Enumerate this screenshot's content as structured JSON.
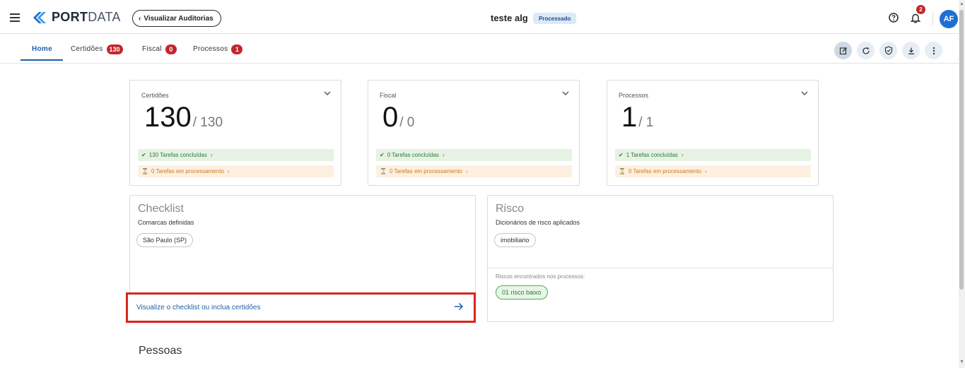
{
  "header": {
    "logo_text_bold": "PORT",
    "logo_text_light": "DATA",
    "back_label": "Visualizar Auditorias",
    "title": "teste alg",
    "status": "Processado",
    "notifications_count": "2",
    "avatar_initials": "AF",
    "accent_color": "#1f6ed4"
  },
  "tabs": [
    {
      "label": "Home",
      "badge": null,
      "active": true
    },
    {
      "label": "Certidões",
      "badge": "130"
    },
    {
      "label": "Fiscal",
      "badge": "0"
    },
    {
      "label": "Processos",
      "badge": "1"
    }
  ],
  "toolbar": {
    "icons": [
      "edit-icon",
      "refresh-icon",
      "shield-check-icon",
      "download-icon",
      "more-vertical-icon"
    ]
  },
  "cards": [
    {
      "label": "Certidões",
      "value": "130",
      "total": "/ 130",
      "done": "130 Tarefas concluídas",
      "processing": "0 Tarefas em processamento"
    },
    {
      "label": "Fiscal",
      "value": "0",
      "total": "/ 0",
      "done": "0 Tarefas concluídas",
      "processing": "0 Tarefas em processamento"
    },
    {
      "label": "Processos",
      "value": "1",
      "total": "/ 1",
      "done": "1 Tarefas concluídas",
      "processing": "0 Tarefas em processamento"
    }
  ],
  "checklist": {
    "title": "Checklist",
    "subtitle": "Comarcas definidas",
    "chip": "São Paulo (SP)",
    "link": "Visualize o checklist ou inclua certidões"
  },
  "risk": {
    "title": "Risco",
    "subtitle": "Dicionários de risco aplicados",
    "chip": "imobiliario",
    "found_label": "Riscos encontrados nos processos:",
    "found_chip": "01 risco baixo"
  },
  "pessoas": {
    "title": "Pessoas"
  }
}
